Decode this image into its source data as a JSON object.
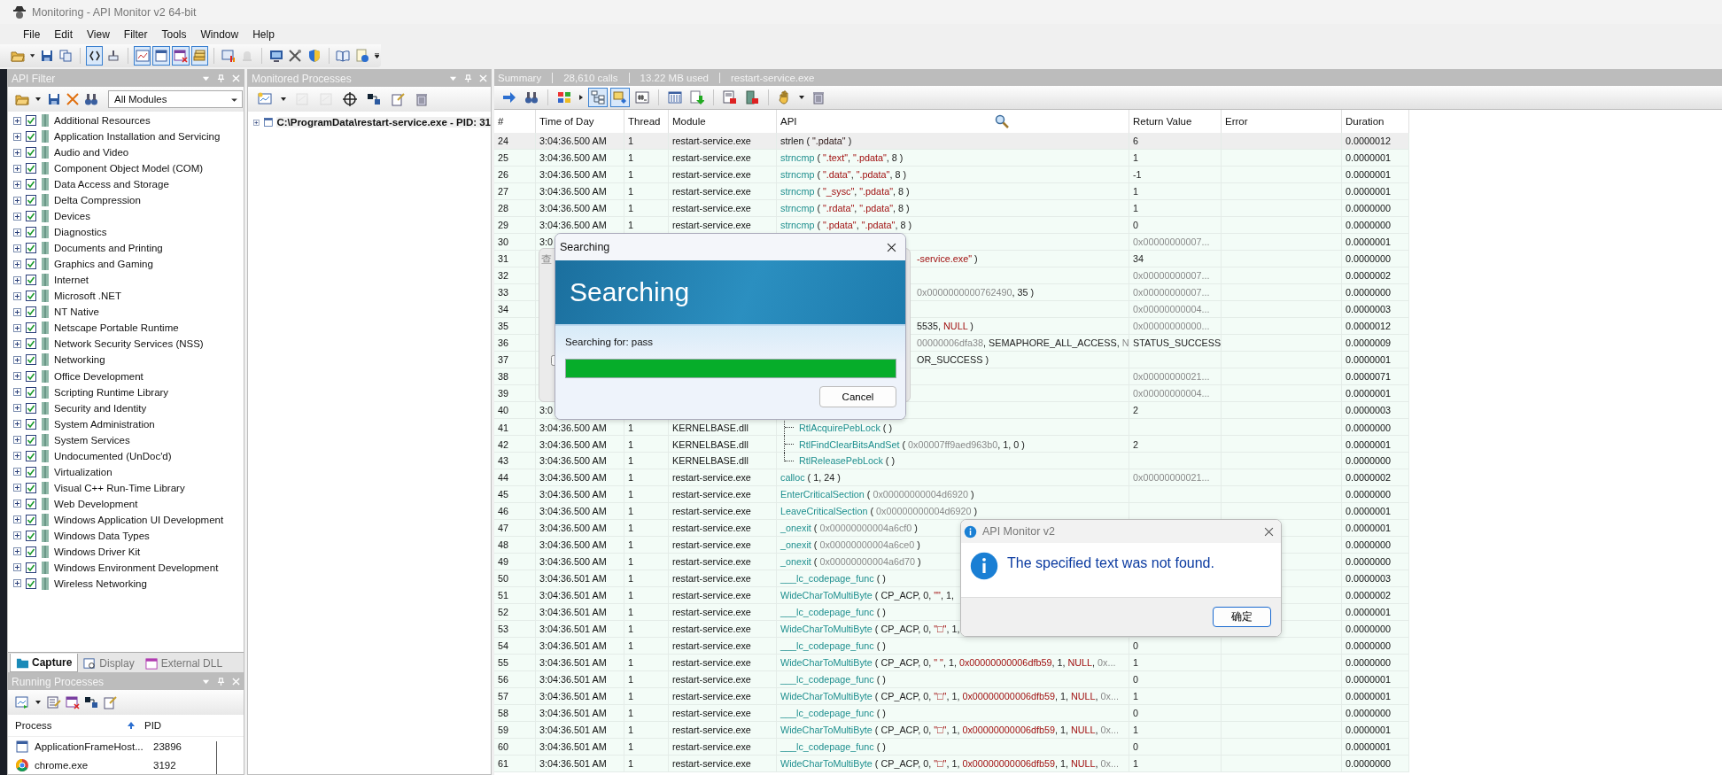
{
  "window": {
    "title": "Monitoring - API Monitor v2 64-bit"
  },
  "menu": [
    "File",
    "Edit",
    "View",
    "Filter",
    "Tools",
    "Window",
    "Help"
  ],
  "toolbar": [
    {
      "pressed": false,
      "disabled": false
    },
    {
      "pressed": false,
      "disabled": false
    },
    {
      "pressed": false,
      "disabled": false
    },
    {
      "pressed": true,
      "disabled": false
    },
    {
      "pressed": false,
      "disabled": false
    },
    {
      "pressed": true,
      "disabled": false
    },
    {
      "pressed": true,
      "disabled": false
    },
    {
      "pressed": true,
      "disabled": false
    },
    {
      "pressed": true,
      "disabled": false
    },
    {
      "pressed": false,
      "disabled": false
    },
    {
      "pressed": false,
      "disabled": true
    },
    {
      "pressed": false,
      "disabled": false
    },
    {
      "pressed": false,
      "disabled": false
    },
    {
      "pressed": false,
      "disabled": false
    },
    {
      "pressed": false,
      "disabled": false
    },
    {
      "pressed": false,
      "disabled": false
    }
  ],
  "api_filter": {
    "title": "API Filter",
    "module_filter": "All Modules",
    "categories": [
      {
        "label": "Additional Resources",
        "checked": true,
        "expanded": false
      },
      {
        "label": "Application Installation and Servicing",
        "checked": true,
        "expanded": false
      },
      {
        "label": "Audio and Video",
        "checked": true,
        "expanded": false
      },
      {
        "label": "Component Object Model (COM)",
        "checked": true,
        "expanded": false
      },
      {
        "label": "Data Access and Storage",
        "checked": true,
        "expanded": false
      },
      {
        "label": "Delta Compression",
        "checked": true,
        "expanded": false
      },
      {
        "label": "Devices",
        "checked": true,
        "expanded": false
      },
      {
        "label": "Diagnostics",
        "checked": true,
        "expanded": false
      },
      {
        "label": "Documents and Printing",
        "checked": true,
        "expanded": false
      },
      {
        "label": "Graphics and Gaming",
        "checked": true,
        "expanded": false
      },
      {
        "label": "Internet",
        "checked": true,
        "expanded": false
      },
      {
        "label": "Microsoft .NET",
        "checked": true,
        "expanded": false
      },
      {
        "label": "NT Native",
        "checked": true,
        "expanded": false
      },
      {
        "label": "Netscape Portable Runtime",
        "checked": true,
        "expanded": false
      },
      {
        "label": "Network Security Services (NSS)",
        "checked": true,
        "expanded": false
      },
      {
        "label": "Networking",
        "checked": true,
        "expanded": false
      },
      {
        "label": "Office Development",
        "checked": true,
        "expanded": false
      },
      {
        "label": "Scripting Runtime Library",
        "checked": true,
        "expanded": false
      },
      {
        "label": "Security and Identity",
        "checked": true,
        "expanded": false
      },
      {
        "label": "System Administration",
        "checked": true,
        "expanded": false
      },
      {
        "label": "System Services",
        "checked": true,
        "expanded": false
      },
      {
        "label": "Undocumented (UnDoc'd)",
        "checked": true,
        "expanded": false
      },
      {
        "label": "Virtualization",
        "checked": true,
        "expanded": false
      },
      {
        "label": "Visual C++ Run-Time Library",
        "checked": true,
        "expanded": false
      },
      {
        "label": "Web Development",
        "checked": true,
        "expanded": false
      },
      {
        "label": "Windows Application UI Development",
        "checked": true,
        "expanded": false
      },
      {
        "label": "Windows Data Types",
        "checked": true,
        "expanded": false
      },
      {
        "label": "Windows Driver Kit",
        "checked": true,
        "expanded": false
      },
      {
        "label": "Windows Environment Development",
        "checked": true,
        "expanded": false
      },
      {
        "label": "Wireless Networking",
        "checked": true,
        "expanded": false
      }
    ],
    "tabs": [
      {
        "label": "Capture",
        "selected": true
      },
      {
        "label": "Display",
        "selected": false
      },
      {
        "label": "External DLL",
        "selected": false
      }
    ]
  },
  "monitored_processes": {
    "title": "Monitored Processes",
    "toolbar": [
      {
        "disabled": false
      },
      {
        "disabled": true
      },
      {
        "disabled": true
      },
      {
        "disabled": false
      },
      {
        "disabled": false
      },
      {
        "disabled": false
      },
      {
        "disabled": false
      }
    ],
    "processes": [
      {
        "label": "C:\\ProgramData\\restart-service.exe - PID: 31",
        "expanded": false
      }
    ]
  },
  "running_processes": {
    "title": "Running Processes",
    "columns": [
      {
        "label": "Process",
        "sorted": true
      },
      {
        "label": "PID",
        "sorted": false
      }
    ],
    "rows": [
      {
        "kind": "window",
        "name": "ApplicationFrameHost...",
        "pid": "23896"
      },
      {
        "kind": "browser",
        "name": "chrome.exe",
        "pid": "3192"
      }
    ]
  },
  "summary": {
    "label": "Summary",
    "calls": "28,610 calls",
    "memory": "13.22 MB used",
    "process": "restart-service.exe"
  },
  "trace_toolbar": [
    {
      "pressed": false
    },
    {
      "pressed": false
    },
    {
      "pressed": false
    },
    {
      "pressed": true
    },
    {
      "pressed": true
    },
    {
      "pressed": false
    },
    {
      "pressed": false
    },
    {
      "pressed": false
    },
    {
      "pressed": false
    },
    {
      "pressed": false
    },
    {
      "pressed": false
    },
    {
      "pressed": false
    }
  ],
  "trace": {
    "columns": [
      "#",
      "Time of Day",
      "Thread",
      "Module",
      "API",
      "Return Value",
      "Error",
      "Duration"
    ],
    "rows": [
      {
        "num": "24",
        "time": "3:04:36.500 AM",
        "thread": "1",
        "module": "restart-service.exe",
        "api": [
          {
            "kind": "function",
            "text": "strlen"
          },
          {
            "kind": "plain",
            "text": " ( "
          },
          {
            "kind": "string",
            "text": "\".pdata\""
          },
          {
            "kind": "plain",
            "text": " )"
          }
        ],
        "ret": {
          "kind": "plain",
          "text": "6"
        },
        "duration": "0.0000012",
        "selected": true
      },
      {
        "num": "25",
        "time": "3:04:36.500 AM",
        "thread": "1",
        "module": "restart-service.exe",
        "api": [
          {
            "kind": "function",
            "text": "strncmp"
          },
          {
            "kind": "plain",
            "text": " ( "
          },
          {
            "kind": "string",
            "text": "\".text\""
          },
          {
            "kind": "plain",
            "text": ", "
          },
          {
            "kind": "string",
            "text": "\".pdata\""
          },
          {
            "kind": "plain",
            "text": ", 8 )"
          }
        ],
        "ret": {
          "kind": "plain",
          "text": "1"
        },
        "duration": "0.0000001",
        "selected": false
      },
      {
        "num": "26",
        "time": "3:04:36.500 AM",
        "thread": "1",
        "module": "restart-service.exe",
        "api": [
          {
            "kind": "function",
            "text": "strncmp"
          },
          {
            "kind": "plain",
            "text": " ( "
          },
          {
            "kind": "string",
            "text": "\".data\""
          },
          {
            "kind": "plain",
            "text": ", "
          },
          {
            "kind": "string",
            "text": "\".pdata\""
          },
          {
            "kind": "plain",
            "text": ", 8 )"
          }
        ],
        "ret": {
          "kind": "plain",
          "text": "-1"
        },
        "duration": "0.0000001",
        "selected": false
      },
      {
        "num": "27",
        "time": "3:04:36.500 AM",
        "thread": "1",
        "module": "restart-service.exe",
        "api": [
          {
            "kind": "function",
            "text": "strncmp"
          },
          {
            "kind": "plain",
            "text": " ( "
          },
          {
            "kind": "string",
            "text": "\"_sysc\""
          },
          {
            "kind": "plain",
            "text": ", "
          },
          {
            "kind": "string",
            "text": "\".pdata\""
          },
          {
            "kind": "plain",
            "text": ", 8 )"
          }
        ],
        "ret": {
          "kind": "plain",
          "text": "1"
        },
        "duration": "0.0000001",
        "selected": false
      },
      {
        "num": "28",
        "time": "3:04:36.500 AM",
        "thread": "1",
        "module": "restart-service.exe",
        "api": [
          {
            "kind": "function",
            "text": "strncmp"
          },
          {
            "kind": "plain",
            "text": " ( "
          },
          {
            "kind": "string",
            "text": "\".rdata\""
          },
          {
            "kind": "plain",
            "text": ", "
          },
          {
            "kind": "string",
            "text": "\".pdata\""
          },
          {
            "kind": "plain",
            "text": ", 8 )"
          }
        ],
        "ret": {
          "kind": "plain",
          "text": "1"
        },
        "duration": "0.0000000",
        "selected": false
      },
      {
        "num": "29",
        "time": "3:04:36.500 AM",
        "thread": "1",
        "module": "restart-service.exe",
        "api": [
          {
            "kind": "function",
            "text": "strncmp"
          },
          {
            "kind": "plain",
            "text": " ( "
          },
          {
            "kind": "string",
            "text": "\".pdata\""
          },
          {
            "kind": "plain",
            "text": ", "
          },
          {
            "kind": "string",
            "text": "\".pdata\""
          },
          {
            "kind": "plain",
            "text": ", 8 )"
          }
        ],
        "ret": {
          "kind": "plain",
          "text": "0"
        },
        "duration": "0.0000000",
        "selected": false
      },
      {
        "num": "30",
        "time": "3:0",
        "ret": {
          "kind": "hex",
          "text": "0x00000000007..."
        },
        "duration": "0.0000001",
        "selected": false
      },
      {
        "num": "31",
        "api": [
          {
            "kind": "string",
            "text": "-service.exe\""
          },
          {
            "kind": "plain",
            "text": " )"
          }
        ],
        "covered": true,
        "ret": {
          "kind": "plain",
          "text": "34"
        },
        "duration": "0.0000000",
        "selected": false
      },
      {
        "num": "32",
        "ret": {
          "kind": "hex",
          "text": "0x00000000007..."
        },
        "duration": "0.0000002",
        "selected": false
      },
      {
        "num": "33",
        "api": [
          {
            "kind": "hex",
            "text": "0x0000000000762490"
          },
          {
            "kind": "plain",
            "text": ", 35 )"
          }
        ],
        "covered": true,
        "ret": {
          "kind": "hex",
          "text": "0x00000000007..."
        },
        "duration": "0.0000000",
        "selected": false
      },
      {
        "num": "34",
        "ret": {
          "kind": "hex",
          "text": "0x00000000004..."
        },
        "duration": "0.0000003",
        "selected": false
      },
      {
        "num": "35",
        "api": [
          {
            "kind": "plain",
            "text": "5535, "
          },
          {
            "kind": "string",
            "text": "NULL"
          },
          {
            "kind": "plain",
            "text": " )"
          }
        ],
        "covered": true,
        "ret": {
          "kind": "hex",
          "text": "0x00000000000..."
        },
        "duration": "0.0000012",
        "selected": false
      },
      {
        "num": "36",
        "api": [
          {
            "kind": "hex",
            "text": "00000006dfa38"
          },
          {
            "kind": "plain",
            "text": ", SEMAPHORE_ALL_ACCESS, "
          },
          {
            "kind": "hex",
            "text": "N"
          }
        ],
        "covered": true,
        "ret": {
          "kind": "plain",
          "text": "STATUS_SUCCESS"
        },
        "duration": "0.0000009",
        "selected": false
      },
      {
        "num": "37",
        "api": [
          {
            "kind": "plain",
            "text": "OR_SUCCESS )"
          }
        ],
        "covered": true,
        "duration": "0.0000001",
        "selected": false
      },
      {
        "num": "38",
        "ret": {
          "kind": "hex",
          "text": "0x00000000021..."
        },
        "duration": "0.0000071",
        "selected": false
      },
      {
        "num": "39",
        "ret": {
          "kind": "hex",
          "text": "0x00000000004..."
        },
        "duration": "0.0000001",
        "selected": false
      },
      {
        "num": "40",
        "time": "3:0",
        "ret": {
          "kind": "plain",
          "text": "2"
        },
        "duration": "0.0000003",
        "selected": false,
        "children": [
          {
            "num": "41",
            "time": "3:04:36.500 AM",
            "thread": "1",
            "module": "KERNELBASE.dll",
            "api": [
              {
                "kind": "function",
                "text": "RtlAcquirePebLock"
              },
              {
                "kind": "plain",
                "text": " ( )"
              }
            ],
            "duration": "0.0000000",
            "selected": false
          },
          {
            "num": "42",
            "time": "3:04:36.500 AM",
            "thread": "1",
            "module": "KERNELBASE.dll",
            "api": [
              {
                "kind": "function",
                "text": "RtlFindClearBitsAndSet"
              },
              {
                "kind": "plain",
                "text": " ( "
              },
              {
                "kind": "hex",
                "text": "0x00007ff9aed963b0"
              },
              {
                "kind": "plain",
                "text": ", 1, 0 )"
              }
            ],
            "ret": {
              "kind": "plain",
              "text": "2"
            },
            "duration": "0.0000001",
            "selected": false
          },
          {
            "num": "43",
            "time": "3:04:36.500 AM",
            "thread": "1",
            "module": "KERNELBASE.dll",
            "api": [
              {
                "kind": "function",
                "text": "RtlReleasePebLock"
              },
              {
                "kind": "plain",
                "text": " ( )"
              }
            ],
            "duration": "0.0000000",
            "selected": false
          }
        ]
      },
      {
        "num": "44",
        "time": "3:04:36.500 AM",
        "thread": "1",
        "module": "restart-service.exe",
        "api": [
          {
            "kind": "function",
            "text": "calloc"
          },
          {
            "kind": "plain",
            "text": " ( 1, 24 )"
          }
        ],
        "ret": {
          "kind": "hex",
          "text": "0x00000000021..."
        },
        "duration": "0.0000002",
        "selected": false
      },
      {
        "num": "45",
        "time": "3:04:36.500 AM",
        "thread": "1",
        "module": "restart-service.exe",
        "api": [
          {
            "kind": "function",
            "text": "EnterCriticalSection"
          },
          {
            "kind": "plain",
            "text": " ( "
          },
          {
            "kind": "hex",
            "text": "0x00000000004d6920"
          },
          {
            "kind": "plain",
            "text": " )"
          }
        ],
        "duration": "0.0000000",
        "selected": false
      },
      {
        "num": "46",
        "time": "3:04:36.500 AM",
        "thread": "1",
        "module": "restart-service.exe",
        "api": [
          {
            "kind": "function",
            "text": "LeaveCriticalSection"
          },
          {
            "kind": "plain",
            "text": " ( "
          },
          {
            "kind": "hex",
            "text": "0x00000000004d6920"
          },
          {
            "kind": "plain",
            "text": " )"
          }
        ],
        "duration": "0.0000001",
        "selected": false
      },
      {
        "num": "47",
        "time": "3:04:36.500 AM",
        "thread": "1",
        "module": "restart-service.exe",
        "api": [
          {
            "kind": "function",
            "text": "_onexit"
          },
          {
            "kind": "plain",
            "text": " ( "
          },
          {
            "kind": "hex",
            "text": "0x00000000004a6cf0"
          },
          {
            "kind": "plain",
            "text": " )"
          }
        ],
        "duration": "0.0000001",
        "selected": false
      },
      {
        "num": "48",
        "time": "3:04:36.500 AM",
        "thread": "1",
        "module": "restart-service.exe",
        "api": [
          {
            "kind": "function",
            "text": "_onexit"
          },
          {
            "kind": "plain",
            "text": " ( "
          },
          {
            "kind": "hex",
            "text": "0x00000000004a6ce0"
          },
          {
            "kind": "plain",
            "text": " )"
          }
        ],
        "duration": "0.0000000",
        "selected": false
      },
      {
        "num": "49",
        "time": "3:04:36.500 AM",
        "thread": "1",
        "module": "restart-service.exe",
        "api": [
          {
            "kind": "function",
            "text": "_onexit"
          },
          {
            "kind": "plain",
            "text": " ( "
          },
          {
            "kind": "hex",
            "text": "0x00000000004a6d70"
          },
          {
            "kind": "plain",
            "text": " )"
          }
        ],
        "duration": "0.0000000",
        "selected": false
      },
      {
        "num": "50",
        "time": "3:04:36.501 AM",
        "thread": "1",
        "module": "restart-service.exe",
        "api": [
          {
            "kind": "function",
            "text": "___lc_codepage_func"
          },
          {
            "kind": "plain",
            "text": " ( )"
          }
        ],
        "duration": "0.0000003",
        "selected": false
      },
      {
        "num": "51",
        "time": "3:04:36.501 AM",
        "thread": "1",
        "module": "restart-service.exe",
        "api": [
          {
            "kind": "function",
            "text": "WideCharToMultiByte"
          },
          {
            "kind": "plain",
            "text": " ( CP_ACP, 0, "
          },
          {
            "kind": "string",
            "text": "\"\""
          },
          {
            "kind": "plain",
            "text": ", 1,"
          }
        ],
        "duration": "0.0000002",
        "selected": false
      },
      {
        "num": "52",
        "time": "3:04:36.501 AM",
        "thread": "1",
        "module": "restart-service.exe",
        "api": [
          {
            "kind": "function",
            "text": "___lc_codepage_func"
          },
          {
            "kind": "plain",
            "text": " ( )"
          }
        ],
        "duration": "0.0000001",
        "selected": false
      },
      {
        "num": "53",
        "time": "3:04:36.501 AM",
        "thread": "1",
        "module": "restart-service.exe",
        "api": [
          {
            "kind": "function",
            "text": "WideCharToMultiByte"
          },
          {
            "kind": "plain",
            "text": " ( CP_ACP, 0, "
          },
          {
            "kind": "string",
            "text": "\"□\""
          },
          {
            "kind": "plain",
            "text": ", 1,"
          }
        ],
        "duration": "0.0000000",
        "selected": false
      },
      {
        "num": "54",
        "time": "3:04:36.501 AM",
        "thread": "1",
        "module": "restart-service.exe",
        "api": [
          {
            "kind": "function",
            "text": "___lc_codepage_func"
          },
          {
            "kind": "plain",
            "text": " ( )"
          }
        ],
        "ret": {
          "kind": "plain",
          "text": "0"
        },
        "duration": "0.0000000",
        "selected": false
      },
      {
        "num": "55",
        "time": "3:04:36.501 AM",
        "thread": "1",
        "module": "restart-service.exe",
        "api": [
          {
            "kind": "function",
            "text": "WideCharToMultiByte"
          },
          {
            "kind": "plain",
            "text": " ( CP_ACP, 0, "
          },
          {
            "kind": "string",
            "text": "\" \""
          },
          {
            "kind": "plain",
            "text": ", 1, "
          },
          {
            "kind": "string",
            "text": "0x00000000006dfb59"
          },
          {
            "kind": "plain",
            "text": ", 1, "
          },
          {
            "kind": "string",
            "text": "NULL"
          },
          {
            "kind": "plain",
            "text": ", "
          },
          {
            "kind": "hex",
            "text": "0x..."
          }
        ],
        "ret": {
          "kind": "plain",
          "text": "1"
        },
        "duration": "0.0000000",
        "selected": false
      },
      {
        "num": "56",
        "time": "3:04:36.501 AM",
        "thread": "1",
        "module": "restart-service.exe",
        "api": [
          {
            "kind": "function",
            "text": "___lc_codepage_func"
          },
          {
            "kind": "plain",
            "text": " ( )"
          }
        ],
        "ret": {
          "kind": "plain",
          "text": "0"
        },
        "duration": "0.0000001",
        "selected": false
      },
      {
        "num": "57",
        "time": "3:04:36.501 AM",
        "thread": "1",
        "module": "restart-service.exe",
        "api": [
          {
            "kind": "function",
            "text": "WideCharToMultiByte"
          },
          {
            "kind": "plain",
            "text": " ( CP_ACP, 0, "
          },
          {
            "kind": "string",
            "text": "\"□\""
          },
          {
            "kind": "plain",
            "text": ", 1, "
          },
          {
            "kind": "string",
            "text": "0x00000000006dfb59"
          },
          {
            "kind": "plain",
            "text": ", 1, "
          },
          {
            "kind": "string",
            "text": "NULL"
          },
          {
            "kind": "plain",
            "text": ", "
          },
          {
            "kind": "hex",
            "text": "0x..."
          }
        ],
        "ret": {
          "kind": "plain",
          "text": "1"
        },
        "duration": "0.0000001",
        "selected": false
      },
      {
        "num": "58",
        "time": "3:04:36.501 AM",
        "thread": "1",
        "module": "restart-service.exe",
        "api": [
          {
            "kind": "function",
            "text": "___lc_codepage_func"
          },
          {
            "kind": "plain",
            "text": " ( )"
          }
        ],
        "ret": {
          "kind": "plain",
          "text": "0"
        },
        "duration": "0.0000000",
        "selected": false
      },
      {
        "num": "59",
        "time": "3:04:36.501 AM",
        "thread": "1",
        "module": "restart-service.exe",
        "api": [
          {
            "kind": "function",
            "text": "WideCharToMultiByte"
          },
          {
            "kind": "plain",
            "text": " ( CP_ACP, 0, "
          },
          {
            "kind": "string",
            "text": "\"□\""
          },
          {
            "kind": "plain",
            "text": ", 1, "
          },
          {
            "kind": "string",
            "text": "0x00000000006dfb59"
          },
          {
            "kind": "plain",
            "text": ", 1, "
          },
          {
            "kind": "string",
            "text": "NULL"
          },
          {
            "kind": "plain",
            "text": ", "
          },
          {
            "kind": "hex",
            "text": "0x..."
          }
        ],
        "ret": {
          "kind": "plain",
          "text": "1"
        },
        "duration": "0.0000001",
        "selected": false
      },
      {
        "num": "60",
        "time": "3:04:36.501 AM",
        "thread": "1",
        "module": "restart-service.exe",
        "api": [
          {
            "kind": "function",
            "text": "___lc_codepage_func"
          },
          {
            "kind": "plain",
            "text": " ( )"
          }
        ],
        "ret": {
          "kind": "plain",
          "text": "0"
        },
        "duration": "0.0000001",
        "selected": false
      },
      {
        "num": "61",
        "time": "3:04:36.501 AM",
        "thread": "1",
        "module": "restart-service.exe",
        "api": [
          {
            "kind": "function",
            "text": "WideCharToMultiByte"
          },
          {
            "kind": "plain",
            "text": " ( CP_ACP, 0, "
          },
          {
            "kind": "string",
            "text": "\"□\""
          },
          {
            "kind": "plain",
            "text": ", 1, "
          },
          {
            "kind": "string",
            "text": "0x00000000006dfb59"
          },
          {
            "kind": "plain",
            "text": ", 1, "
          },
          {
            "kind": "string",
            "text": "NULL"
          },
          {
            "kind": "plain",
            "text": ", "
          },
          {
            "kind": "hex",
            "text": "0x..."
          }
        ],
        "ret": {
          "kind": "plain",
          "text": "1"
        },
        "duration": "0.0000000",
        "selected": false
      }
    ]
  },
  "background_dialog": {
    "title": "查",
    "checked": false
  },
  "search_dialog": {
    "title": "Searching",
    "heading": "Searching",
    "status": "Searching for: pass",
    "level": 1,
    "cancel": "Cancel"
  },
  "message_dialog": {
    "title": "API Monitor v2",
    "message": "The specified text was not found.",
    "ok": "确定"
  }
}
